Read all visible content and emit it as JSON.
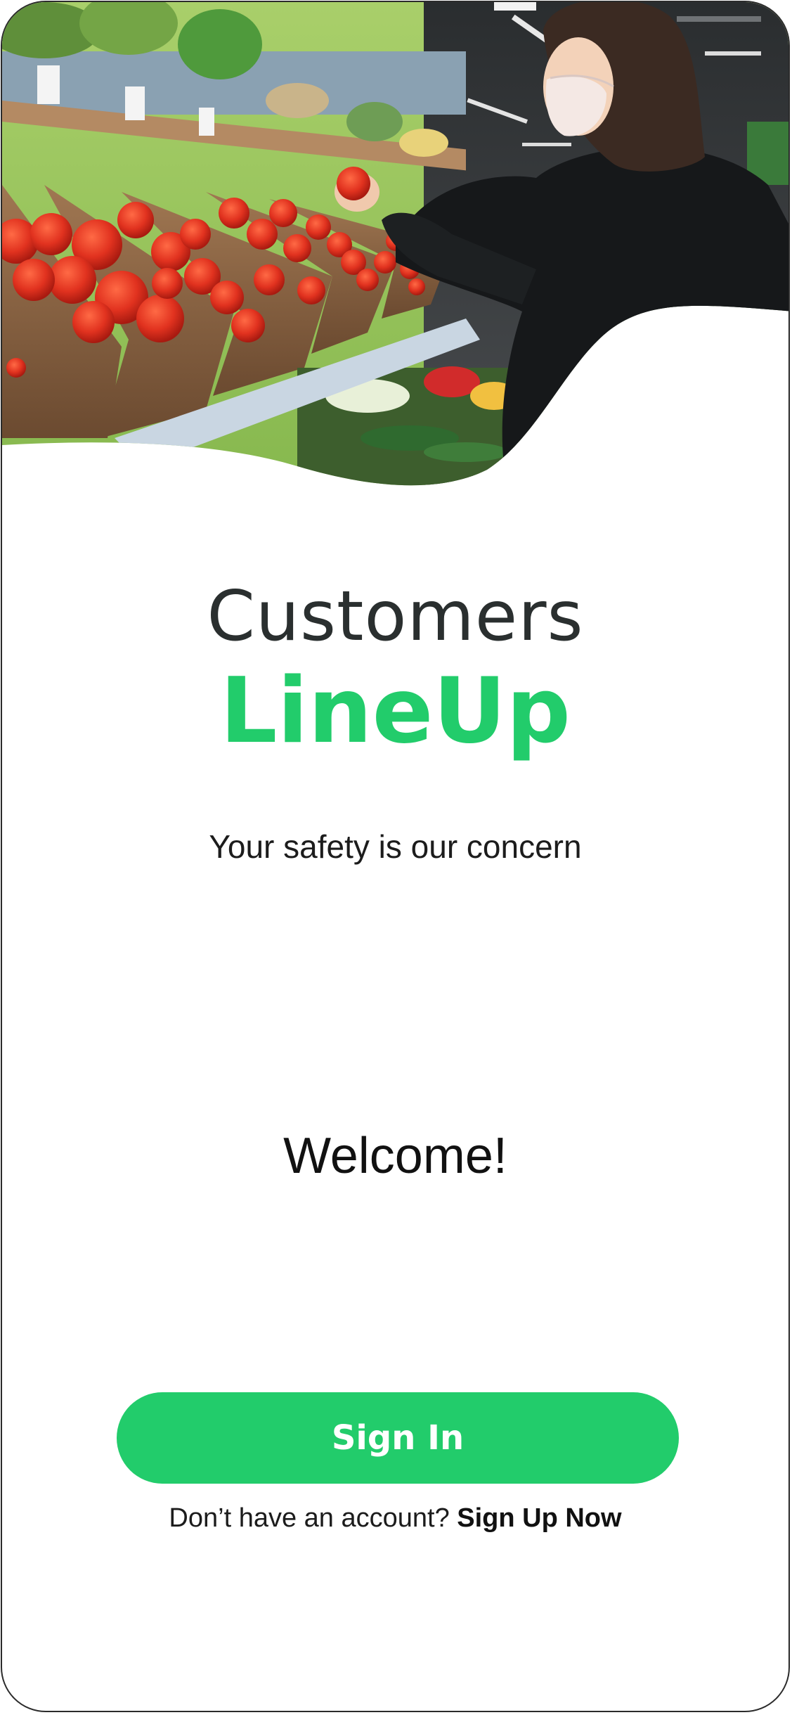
{
  "brand": {
    "line1": "Customers",
    "line2": "LineUp",
    "accent_color": "#22cc6b",
    "text_color": "#2a2f2f"
  },
  "tagline": "Your safety is our concern",
  "welcome": "Welcome!",
  "signin": {
    "label": "Sign In"
  },
  "signup": {
    "prompt": "Don’t have an account?",
    "link_label": "Sign Up Now"
  },
  "hero": {
    "image": "grocery-store-woman-picking-tomato-photo"
  }
}
